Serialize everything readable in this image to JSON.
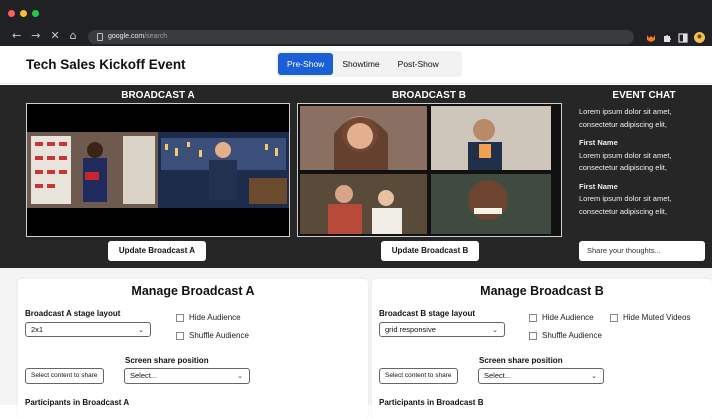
{
  "browser": {
    "url_host": "google.com",
    "url_path": "/search",
    "dot_colors": [
      "#ff5f57",
      "#febc2e",
      "#28c840"
    ],
    "nav": {
      "back": "←",
      "forward": "→",
      "close": "✕",
      "home": "⌂"
    }
  },
  "event": {
    "title": "Tech Sales Kickoff Event"
  },
  "tabs": [
    {
      "label": "Pre-Show",
      "active": true
    },
    {
      "label": "Showtime",
      "active": false
    },
    {
      "label": "Post-Show",
      "active": false
    }
  ],
  "broadcast_a": {
    "heading": "BROADCAST A",
    "update_label": "Update Broadcast A"
  },
  "broadcast_b": {
    "heading": "BROADCAST B",
    "update_label": "Update Broadcast B"
  },
  "chat": {
    "heading": "EVENT CHAT",
    "first_message": "Lorem ipsum dolor sit amet, consectetur adipiscing elit,",
    "messages": [
      {
        "name": "First Name",
        "text": "Lorem ipsum dolor sit amet, consectetur adipiscing elit,"
      },
      {
        "name": "First Name",
        "text": "Lorem ipsum dolor sit amet, consectetur adipiscing elit,"
      }
    ],
    "input_placeholder": "Share your thoughts..."
  },
  "manage_a": {
    "title": "Manage Broadcast A",
    "layout_label": "Broadcast A stage layout",
    "layout_value": "2x1",
    "hide_audience": "Hide Audience",
    "shuffle_audience": "Shuffle Audience",
    "screen_share_label": "Screen share position",
    "select_content": "Select content to share",
    "select_placeholder": "Select...",
    "participants_label": "Participants in Broadcast A"
  },
  "manage_b": {
    "title": "Manage Broadcast B",
    "layout_label": "Broadcast B stage layout",
    "layout_value": "grid responsive",
    "hide_audience": "Hide Audience",
    "hide_muted": "Hide Muted Videos",
    "shuffle_audience": "Shuffle Audience",
    "screen_share_label": "Screen share position",
    "select_content": "Select content to share",
    "select_placeholder": "Select...",
    "participants_label": "Participants in Broadcast B"
  },
  "colors": {
    "accent": "#1a5fd6",
    "stage_bg": "#262626",
    "chrome_bg": "#202124"
  }
}
